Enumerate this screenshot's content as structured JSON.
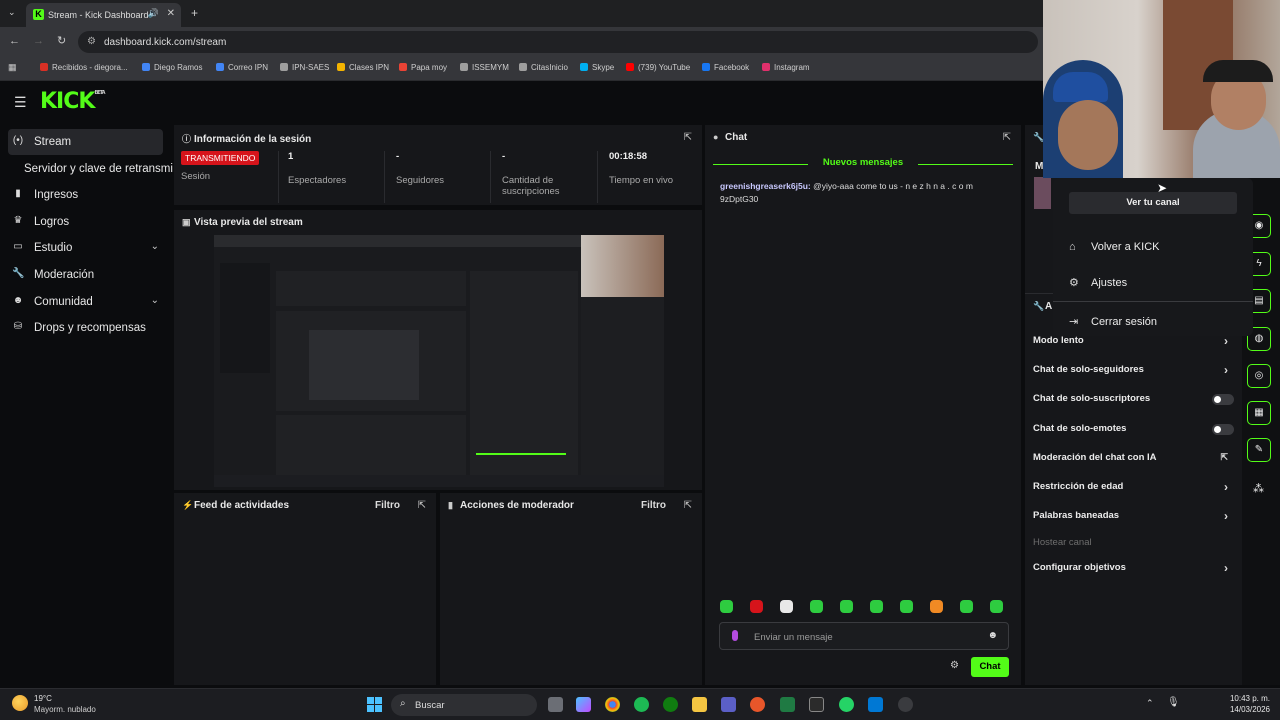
{
  "browser": {
    "tab_title": "Stream - Kick Dashboard",
    "url": "dashboard.kick.com/stream",
    "bookmarks": [
      {
        "label": "Recibidos - diegora...",
        "color": "#d93025"
      },
      {
        "label": "Diego Ramos",
        "color": "#4285f4"
      },
      {
        "label": "Correo IPN",
        "color": "#4285f4"
      },
      {
        "label": "IPN-SAES",
        "color": "#9e9e9e"
      },
      {
        "label": "Clases IPN",
        "color": "#f4b400"
      },
      {
        "label": "Papa moy",
        "color": "#ea4335"
      },
      {
        "label": "ISSEMYM",
        "color": "#9e9e9e"
      },
      {
        "label": "CitasInicio",
        "color": "#9e9e9e"
      },
      {
        "label": "Skype",
        "color": "#00aff0"
      },
      {
        "label": "(739) YouTube",
        "color": "#ff0000"
      },
      {
        "label": "Facebook",
        "color": "#1877f2"
      },
      {
        "label": "Instagram",
        "color": "#e1306c"
      }
    ]
  },
  "header": {
    "logo": "KICK",
    "beta": "BETA"
  },
  "sidebar": {
    "items": [
      {
        "label": "Stream",
        "icon": "broadcast-icon"
      },
      {
        "label": "Servidor y clave de retransmi",
        "icon": ""
      },
      {
        "label": "Ingresos",
        "icon": "chart-icon"
      },
      {
        "label": "Logros",
        "icon": "trophy-icon"
      },
      {
        "label": "Estudio",
        "icon": "studio-icon"
      },
      {
        "label": "Moderación",
        "icon": "wrench-icon"
      },
      {
        "label": "Comunidad",
        "icon": "community-icon"
      },
      {
        "label": "Drops y recompensas",
        "icon": "drops-icon"
      }
    ]
  },
  "session": {
    "title": "Información de la sesión",
    "badge": "TRANSMITIENDO",
    "stats": [
      {
        "label": "Sesión",
        "value": ""
      },
      {
        "label": "Espectadores",
        "value": "1"
      },
      {
        "label": "Seguidores",
        "value": "-"
      },
      {
        "label": "Cantidad de suscripciones",
        "value": "-"
      },
      {
        "label": "Tiempo en vivo",
        "value": "00:18:58"
      }
    ]
  },
  "preview": {
    "title": "Vista previa del stream"
  },
  "activity": {
    "title": "Feed de actividades",
    "filter": "Filtro"
  },
  "modactions": {
    "title": "Acciones de moderador",
    "filter": "Filtro"
  },
  "chat": {
    "title": "Chat",
    "new_messages": "Nuevos mensajes",
    "message_user": "greenishgreaserk6j5u:",
    "message_text": "@yiyo-aaa come to us - n e z h n a . c o m 9zDptG30",
    "input_placeholder": "Enviar un mensaje",
    "send_label": "Chat",
    "emote_colors": [
      "#2ecc40",
      "#d6141b",
      "#e8e8e8",
      "#2ecc40",
      "#2ecc40",
      "#2ecc40",
      "#2ecc40",
      "#f08a24",
      "#2ecc40",
      "#2ecc40"
    ]
  },
  "mod_settings": {
    "header_fragment": "A",
    "items": [
      {
        "label": "Modo lento",
        "control": "arrow"
      },
      {
        "label": "Chat de solo-seguidores",
        "control": "arrow"
      },
      {
        "label": "Chat de solo-suscriptores",
        "control": "toggle"
      },
      {
        "label": "Chat de solo-emotes",
        "control": "toggle"
      },
      {
        "label": "Moderación del chat con IA",
        "control": "external"
      },
      {
        "label": "Restricción de edad",
        "control": "arrow"
      },
      {
        "label": "Palabras baneadas",
        "control": "arrow"
      },
      {
        "label": "Hostear canal",
        "control": "none"
      },
      {
        "label": "Configurar objetivos",
        "control": "arrow"
      }
    ]
  },
  "user_menu": {
    "view_channel": "Ver tu canal",
    "items": [
      {
        "label": "Volver a KICK",
        "icon": "home-icon"
      },
      {
        "label": "Ajustes",
        "icon": "gear-icon"
      },
      {
        "label": "Cerrar sesión",
        "icon": "logout-icon"
      }
    ]
  },
  "taskbar": {
    "temp": "19°C",
    "condition": "Mayorm. nublado",
    "search": "Buscar",
    "time": "10:43 p. m.",
    "date": "14/03/2026"
  },
  "colors": {
    "accent": "#53fc18",
    "live": "#d6141b"
  }
}
